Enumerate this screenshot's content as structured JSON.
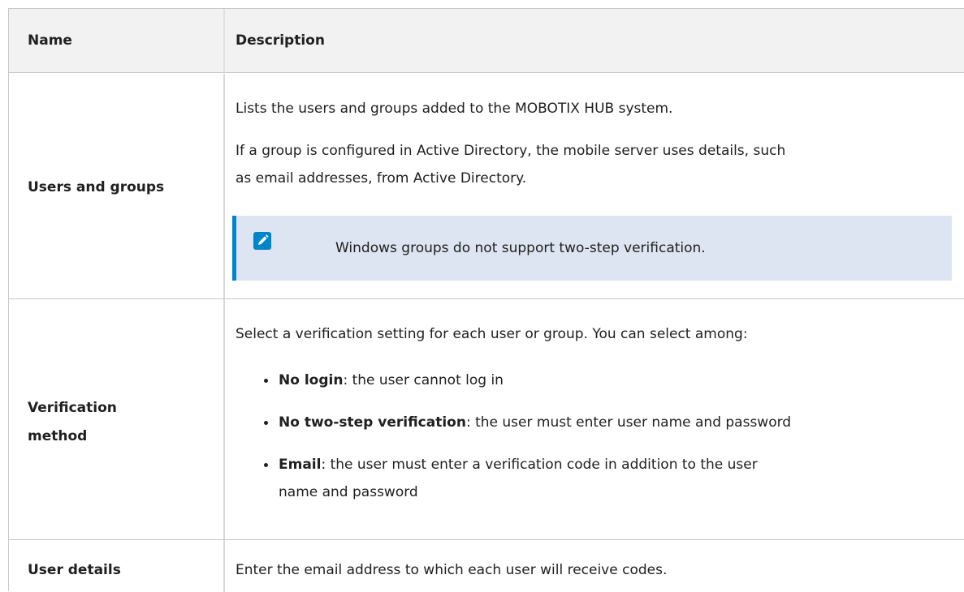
{
  "table": {
    "headers": {
      "name": "Name",
      "description": "Description"
    },
    "rows": [
      {
        "name": "Users and groups",
        "paragraphs": [
          "Lists the users and groups added to the MOBOTIX HUB system.",
          "If a group is configured in Active Directory, the mobile server uses details, such",
          "as email addresses, from Active Directory."
        ],
        "note": {
          "icon": "pencil-note-icon",
          "text": "Windows groups do not support two-step verification."
        }
      },
      {
        "name_lines": [
          "Verification",
          "method"
        ],
        "intro": "Select a verification setting for each user or group. You can select among:",
        "options": [
          {
            "term": "No login",
            "text": ": the user cannot log in"
          },
          {
            "term": "No two-step verification",
            "text": ": the user must enter user name and password"
          },
          {
            "term": "Email",
            "text": ": the user must enter a verification code in addition to the user",
            "text2": "name and password"
          }
        ]
      },
      {
        "name": "User details",
        "text": "Enter the email address to which each user will receive codes."
      }
    ]
  },
  "colors": {
    "header_bg": "#f2f2f2",
    "note_bg": "#dce5f1",
    "accent": "#0085ca",
    "border": "#c8c8c8"
  }
}
